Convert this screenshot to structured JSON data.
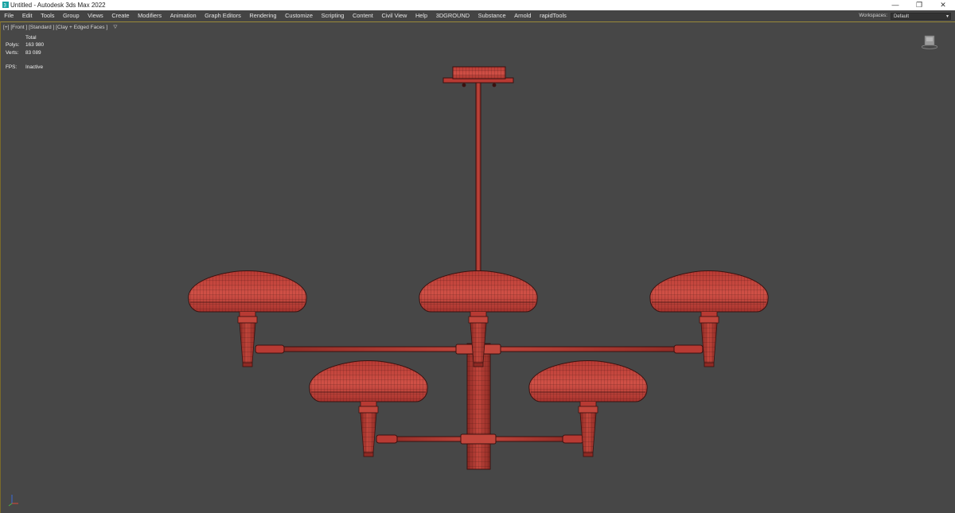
{
  "window": {
    "title": "Untitled - Autodesk 3ds Max 2022",
    "minimize": "—",
    "restore": "❐",
    "close": "✕"
  },
  "menu": {
    "items": [
      "File",
      "Edit",
      "Tools",
      "Group",
      "Views",
      "Create",
      "Modifiers",
      "Animation",
      "Graph Editors",
      "Rendering",
      "Customize",
      "Scripting",
      "Content",
      "Civil View",
      "Help",
      "3DGROUND",
      "Substance",
      "Arnold",
      "rapidTools"
    ],
    "workspaces_label": "Workspaces:",
    "workspaces_value": "Default"
  },
  "viewport": {
    "label": "[+] [Front ] [Standard ] [Clay + Edged Faces ]",
    "filter_icon": "filter-icon",
    "stats": {
      "header": "Total",
      "polys_label": "Polys:",
      "polys_value": "163 980",
      "verts_label": "Verts:",
      "verts_value": "83 089",
      "fps_label": "FPS:",
      "fps_value": "Inactive"
    }
  },
  "colors": {
    "viewport_bg": "#474747",
    "model_fill": "#c0453b",
    "wire": "#3a1210",
    "menubar_bg": "#444444"
  }
}
